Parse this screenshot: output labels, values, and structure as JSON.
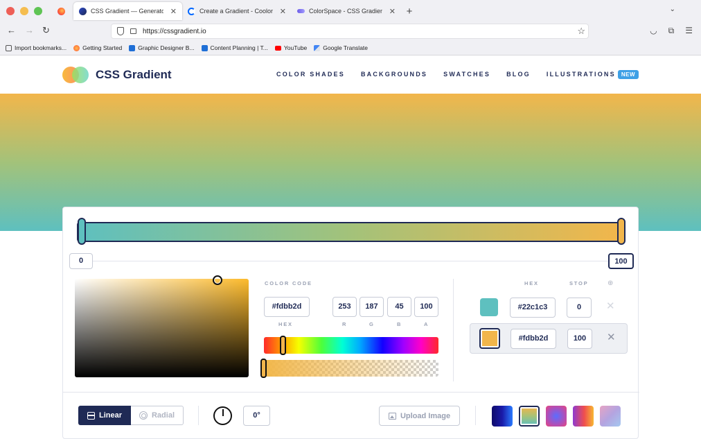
{
  "browser": {
    "tabs": [
      {
        "title": "CSS Gradient — Generator, Mak",
        "active": true
      },
      {
        "title": "Create a Gradient - Coolors",
        "active": false
      },
      {
        "title": "ColorSpace - CSS Gradient Colo",
        "active": false
      }
    ],
    "url": "https://cssgradient.io",
    "bookmarks": [
      "Import bookmarks...",
      "Getting Started",
      "Graphic Designer B...",
      "Content Planning | T...",
      "YouTube",
      "Google Translate"
    ]
  },
  "site": {
    "logo_text": "CSS Gradient",
    "nav": [
      "COLOR SHADES",
      "BACKGROUNDS",
      "SWATCHES",
      "BLOG",
      "ILLUSTRATIONS"
    ],
    "nav_badge": "NEW"
  },
  "editor": {
    "stop_left_value": "0",
    "stop_right_value": "100",
    "color_code_label": "COLOR CODE",
    "hex_value": "#fdbb2d",
    "hex_label": "HEX",
    "rgba": [
      {
        "label": "R",
        "value": "253"
      },
      {
        "label": "G",
        "value": "187"
      },
      {
        "label": "B",
        "value": "45"
      },
      {
        "label": "A",
        "value": "100"
      }
    ],
    "stops_header": {
      "hex": "HEX",
      "stop": "STOP"
    },
    "stops": [
      {
        "hex": "#22c1c3",
        "stop": "0",
        "color": "#5ec0bf",
        "selected": false
      },
      {
        "hex": "#fdbb2d",
        "stop": "100",
        "color": "#f2b64b",
        "selected": true
      }
    ],
    "delete_glyph": "✕",
    "type_linear": "Linear",
    "type_radial": "Radial",
    "angle_value": "0°",
    "upload_label": "Upload Image"
  },
  "colors": {
    "navy": "#1f2a55",
    "teal": "#5ec0bf",
    "gold": "#f2b64b",
    "badge": "#3ea0e6"
  }
}
